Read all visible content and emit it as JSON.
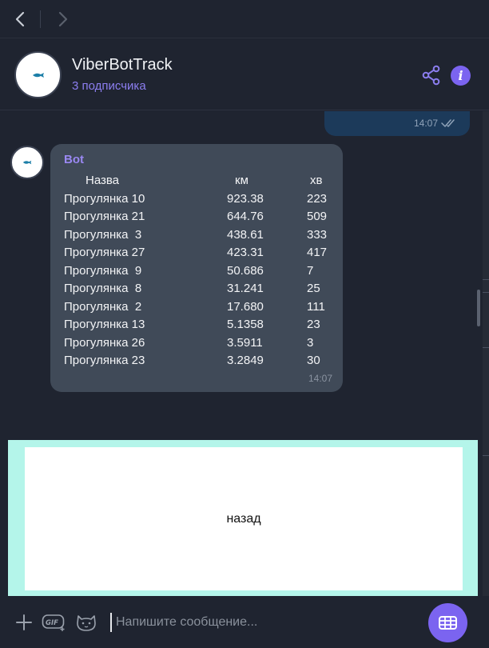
{
  "nav": {
    "back_label": "back",
    "forward_label": "forward"
  },
  "header": {
    "title": "ViberBotTrack",
    "subtitle": "3 подписчика"
  },
  "outgoing_message": {
    "time": "14:07"
  },
  "bot_message": {
    "sender": "Bot",
    "columns": [
      "Назва",
      "км",
      "хв"
    ],
    "rows": [
      [
        "Прогулянка 10",
        "923.38",
        "223"
      ],
      [
        "Прогулянка 21",
        "644.76",
        "509"
      ],
      [
        "Прогулянка  3",
        "438.61",
        "333"
      ],
      [
        "Прогулянка 27",
        "423.31",
        "417"
      ],
      [
        "Прогулянка  9",
        "50.686",
        "7"
      ],
      [
        "Прогулянка  8",
        "31.241",
        "25"
      ],
      [
        "Прогулянка  2",
        "17.680",
        "111"
      ],
      [
        "Прогулянка 13",
        "5.1358",
        "23"
      ],
      [
        "Прогулянка 26",
        "3.5911",
        "3"
      ],
      [
        "Прогулянка 23",
        "3.2849",
        "30"
      ]
    ],
    "time": "14:07"
  },
  "keyboard": {
    "button_label": "назад"
  },
  "composer": {
    "placeholder": "Напишите сообщение..."
  },
  "colors": {
    "background": "#1f2430",
    "accent": "#7b64f0",
    "incoming_bubble": "#404a58",
    "outgoing_bubble": "#1c3a5a",
    "keyboard_panel": "#b4f5ea"
  },
  "icons": [
    "back-icon",
    "forward-icon",
    "share-icon",
    "info-icon",
    "double-check-icon",
    "plus-icon",
    "gif-icon",
    "sticker-icon",
    "keyboard-icon"
  ]
}
